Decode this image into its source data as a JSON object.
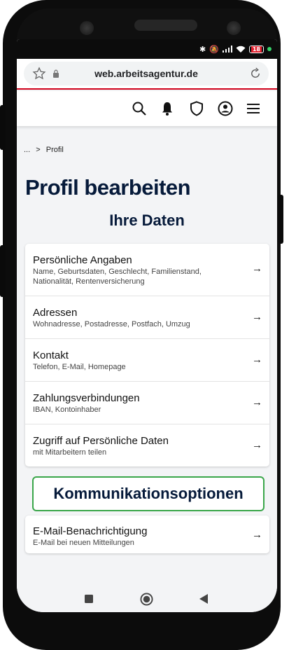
{
  "status_bar": {
    "battery": "18"
  },
  "browser": {
    "url": "web.arbeitsagentur.de"
  },
  "breadcrumb": {
    "ellipsis": "...",
    "separator": ">",
    "current": "Profil"
  },
  "page": {
    "title": "Profil bearbeiten",
    "section_title": "Ihre Daten"
  },
  "daten_items": [
    {
      "title": "Persönliche Angaben",
      "subtitle": "Name, Geburtsdaten, Geschlecht, Familienstand, Nationalität, Rentenversicherung"
    },
    {
      "title": "Adressen",
      "subtitle": "Wohnadresse, Postadresse, Postfach, Umzug"
    },
    {
      "title": "Kontakt",
      "subtitle": "Telefon, E-Mail, Homepage"
    },
    {
      "title": "Zahlungsverbindungen",
      "subtitle": "IBAN, Kontoinhaber"
    },
    {
      "title": "Zugriff auf Persönliche Daten",
      "subtitle": "mit Mitarbeitern teilen"
    }
  ],
  "kommunikation": {
    "heading": "Kommunikationsoptionen",
    "items": [
      {
        "title": "E-Mail-Benachrichtigung",
        "subtitle": "E-Mail bei neuen Mitteilungen"
      }
    ]
  },
  "arrow": "→",
  "colors": {
    "brand_red": "#d0021b",
    "heading_navy": "#061a3a",
    "accent_green": "#3aa64a"
  }
}
